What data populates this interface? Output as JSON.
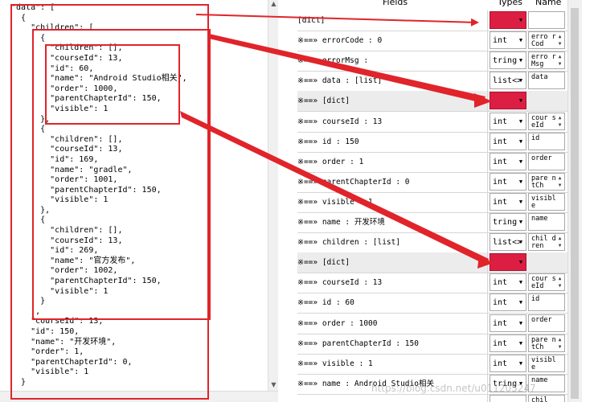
{
  "json_text": "\"data\": [\n  {\n    \"children\": [\n      {\n        \"children\": [],\n        \"courseId\": 13,\n        \"id\": 60,\n        \"name\": \"Android Studio相关\",\n        \"order\": 1000,\n        \"parentChapterId\": 150,\n        \"visible\": 1\n      },\n      {\n        \"children\": [],\n        \"courseId\": 13,\n        \"id\": 169,\n        \"name\": \"gradle\",\n        \"order\": 1001,\n        \"parentChapterId\": 150,\n        \"visible\": 1\n      },\n      {\n        \"children\": [],\n        \"courseId\": 13,\n        \"id\": 269,\n        \"name\": \"官方发布\",\n        \"order\": 1002,\n        \"parentChapterId\": 150,\n        \"visible\": 1\n      }\n    ],\n    \"courseId\": 13,\n    \"id\": 150,\n    \"name\": \"开发环境\",\n    \"order\": 1,\n    \"parentChapterId\": 0,\n    \"visible\": 1\n  }",
  "header": {
    "fields": "Fields",
    "types": "Types",
    "name": "Name"
  },
  "rows": [
    {
      "field": "[dict]",
      "type": "",
      "name": ""
    },
    {
      "field": "※==» errorCode : 0",
      "type": "int",
      "name": "erro rCod"
    },
    {
      "field": "※==» errorMsg :",
      "type": "tring",
      "name": "erro rMsg"
    },
    {
      "field": "※==» data : [list]",
      "type": "list<>",
      "name": "data"
    },
    {
      "field": "    ※==» [dict]",
      "type": "",
      "name": ""
    },
    {
      "field": "        ※==» courseId : 13",
      "type": "int",
      "name": "cour seId"
    },
    {
      "field": "        ※==» id : 150",
      "type": "int",
      "name": "id"
    },
    {
      "field": "        ※==» order : 1",
      "type": "int",
      "name": "order"
    },
    {
      "field": "        ※==» parentChapterId : 0",
      "type": "int",
      "name": "pare ntCh"
    },
    {
      "field": "        ※==» visible : 1",
      "type": "int",
      "name": "visible"
    },
    {
      "field": "        ※==» name : 开发环境",
      "type": "tring",
      "name": "name"
    },
    {
      "field": "        ※==» children : [list]",
      "type": "list<>",
      "name": "chil dren"
    },
    {
      "field": "            ※==» [dict]",
      "type": "",
      "name": ""
    },
    {
      "field": "                ※==» courseId : 13",
      "type": "int",
      "name": "cour seId"
    },
    {
      "field": "                ※==» id : 60",
      "type": "int",
      "name": "id"
    },
    {
      "field": "                ※==» order : 1000",
      "type": "int",
      "name": "order"
    },
    {
      "field": "                ※==» parentChapterId : 150",
      "type": "int",
      "name": "pare ntCh"
    },
    {
      "field": "                ※==» visible : 1",
      "type": "int",
      "name": "visible"
    },
    {
      "field": "                ※==» name : Android Studio相关",
      "type": "tring",
      "name": "name"
    },
    {
      "field": "",
      "type": "",
      "name": "chil"
    }
  ],
  "watermark": "https://blog.csdn.net/u011205247",
  "colors": {
    "highlight_red": "#e0242a",
    "dict_type_red": "#dc1e42"
  },
  "icons": {
    "dropdown": "chevron-down-icon",
    "spinner": "spin-arrows-icon"
  }
}
